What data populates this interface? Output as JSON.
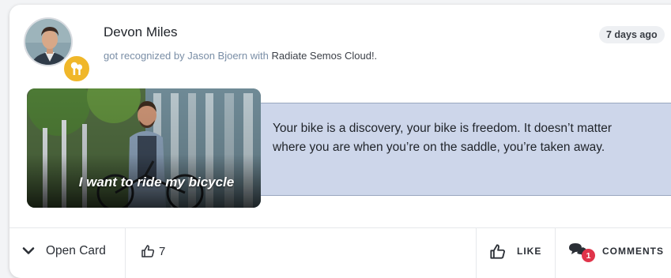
{
  "post": {
    "user_name": "Devon Miles",
    "action_text": "got recognized by Jason Bjoern with",
    "award_name": "Radiate Semos Cloud!.",
    "time_ago": "7 days ago",
    "photo_caption": "I want to ride my bicycle",
    "quote": "Your bike is a discovery, your bike is freedom. It doesn’t matter where you are when you’re on the saddle, you’re taken away."
  },
  "footer": {
    "open_card_label": "Open Card",
    "likes_count": "7",
    "like_label": "LIKE",
    "comments_label": "COMMENTS",
    "comments_count": "1"
  },
  "colors": {
    "badge": "#f0b72a",
    "quote_background": "#cdd6ea",
    "comment_count_badge": "#e0344a",
    "link_text": "#7a8ea6"
  },
  "icons": [
    "avatar",
    "award-badge-icon",
    "chevron-down-icon",
    "thumbs-up-icon",
    "comments-icon"
  ]
}
